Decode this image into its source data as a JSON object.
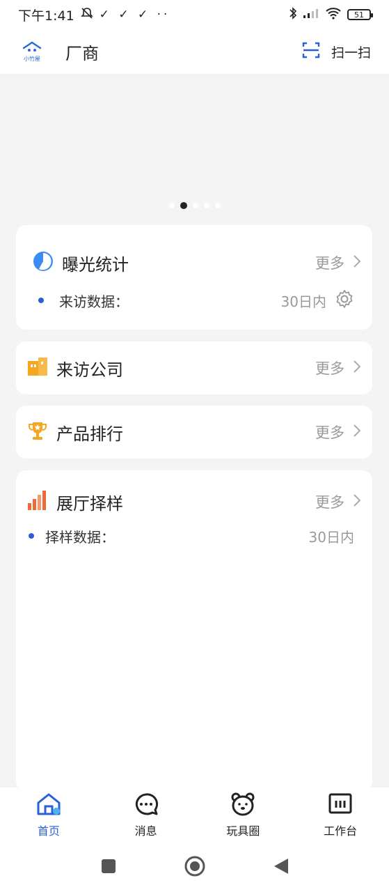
{
  "status_bar": {
    "time": "下午1:41",
    "extra_icons": "✓ ✓ ✓ ··",
    "battery": "51"
  },
  "header": {
    "logo_text": "小竹屋",
    "title": "厂商",
    "scan_label": "扫一扫"
  },
  "banner": {
    "dots": 5,
    "active_dot": 1
  },
  "cards": {
    "exposure": {
      "title": "曝光统计",
      "more": "更多",
      "sub_label": "来访数据：",
      "sub_value": "30日内"
    },
    "visitors": {
      "title": "来访公司",
      "more": "更多"
    },
    "ranking": {
      "title": "产品排行",
      "more": "更多"
    },
    "showroom": {
      "title": "展厅择样",
      "more": "更多",
      "sub_label": "择样数据：",
      "sub_value": "30日内"
    }
  },
  "tabbar": {
    "home": "首页",
    "messages": "消息",
    "toy_circle": "玩具圈",
    "workbench": "工作台"
  },
  "colors": {
    "accent": "#2a62d4",
    "orange": "#f5a623",
    "chart_orange": "#ef6a3a"
  }
}
